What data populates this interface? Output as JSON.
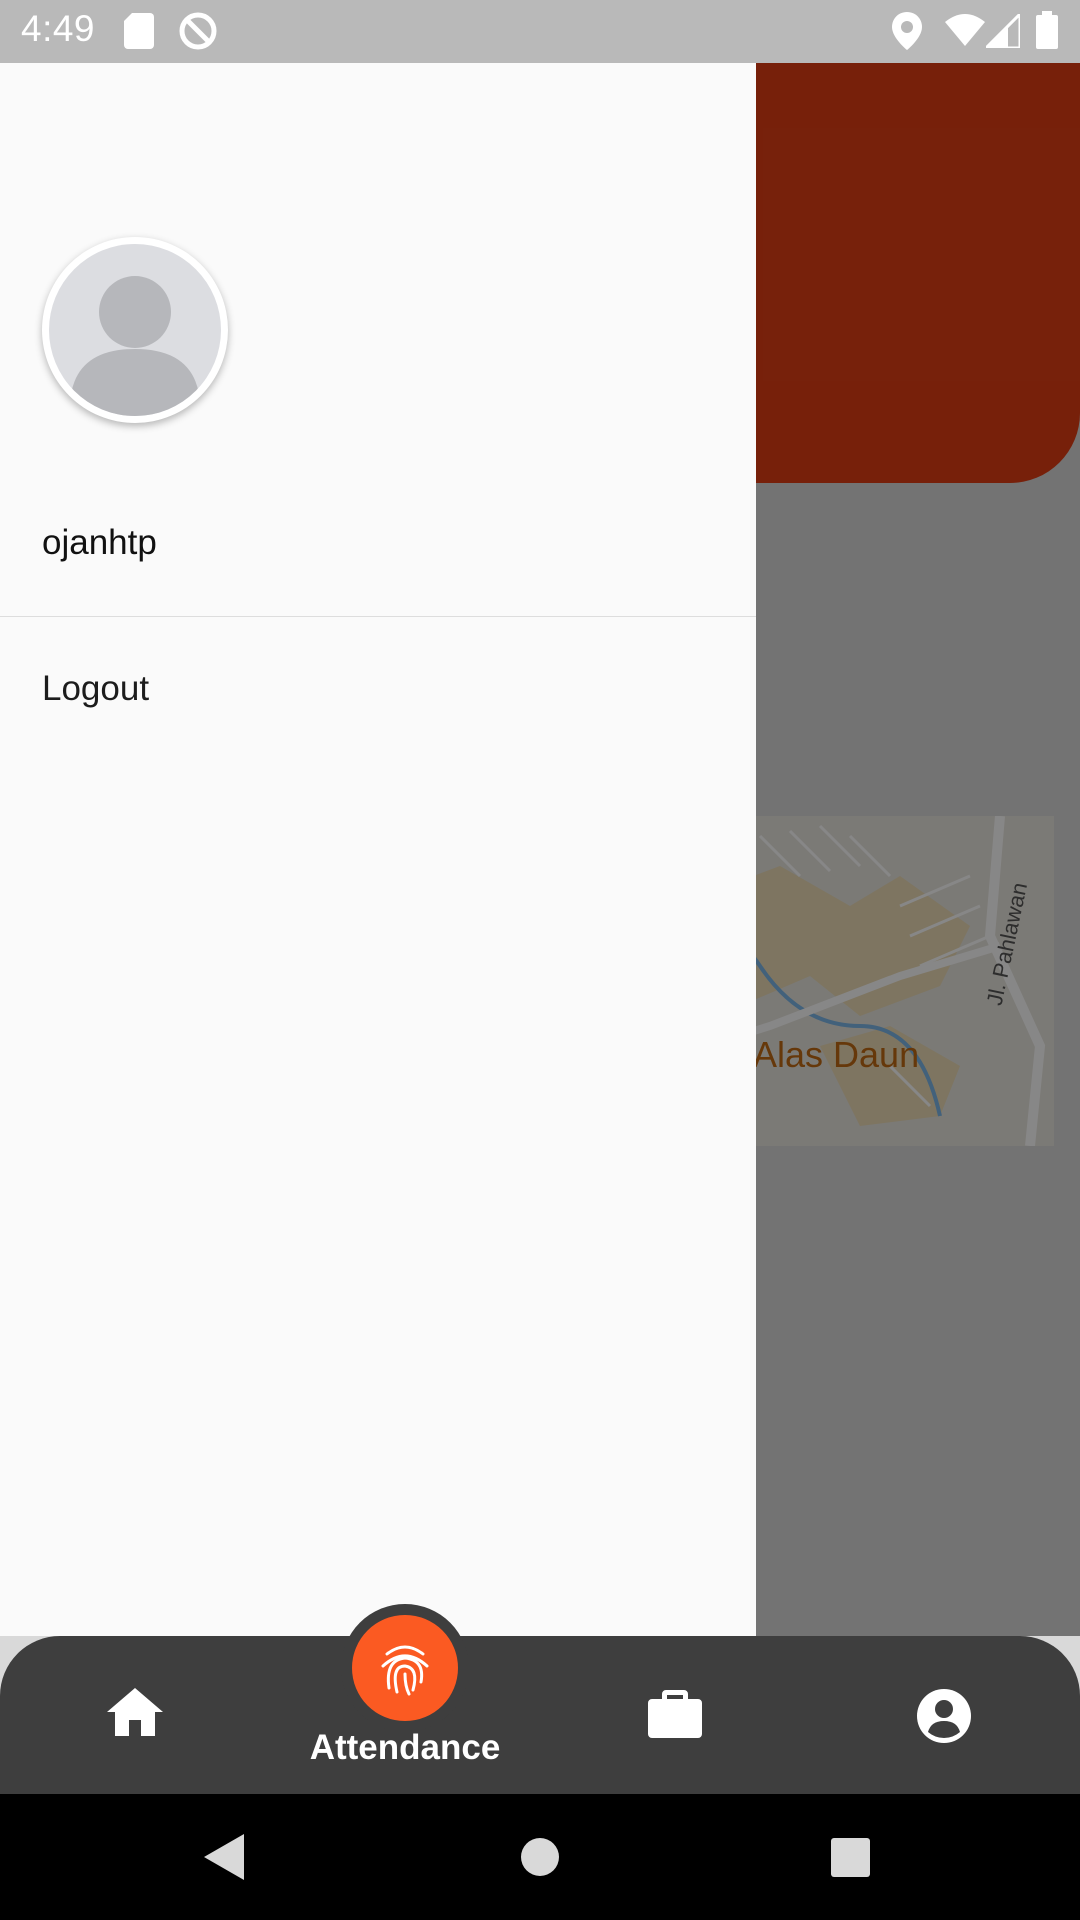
{
  "status_bar": {
    "time": "4:49",
    "left_icons": [
      "sd-card-icon",
      "sync-disabled-icon"
    ],
    "right_icons": [
      "location-icon",
      "wifi-icon",
      "signal-icon",
      "battery-icon"
    ]
  },
  "background": {
    "header_color": "#e03e14",
    "map": {
      "place_label": "Alas Daun",
      "road_label": "Jl. Pahlawan"
    }
  },
  "drawer": {
    "avatar_icon": "person-avatar-icon",
    "username": "ojanhtp",
    "menu": [
      {
        "label": "Logout"
      }
    ]
  },
  "bottom_nav": {
    "background": "#3e3e3e",
    "accent": "#fb5a22",
    "items": [
      {
        "icon": "home-icon",
        "label": ""
      },
      {
        "icon": "fingerprint-icon",
        "label": "Attendance",
        "active": true
      },
      {
        "icon": "briefcase-icon",
        "label": ""
      },
      {
        "icon": "account-circle-icon",
        "label": ""
      }
    ]
  },
  "system_nav": {
    "buttons": [
      "back-icon",
      "home-circle-icon",
      "recents-icon"
    ]
  }
}
